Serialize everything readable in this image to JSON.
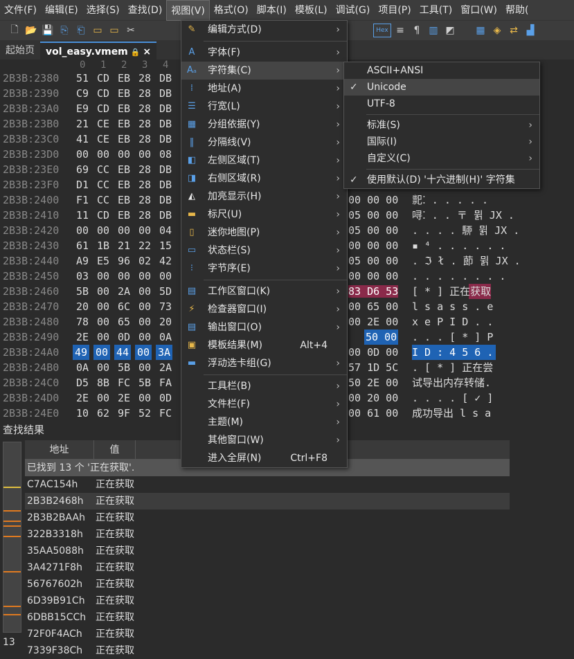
{
  "menubar": [
    "文件(F)",
    "编辑(E)",
    "选择(S)",
    "查找(D)",
    "视图(V)",
    "格式(O)",
    "脚本(I)",
    "模板(L)",
    "调试(G)",
    "项目(P)",
    "工具(T)",
    "窗口(W)",
    "帮助("
  ],
  "tabs": {
    "start": "起始页",
    "file": "vol_easy.vmem",
    "close": "×"
  },
  "editor": {
    "col_header": [
      "0",
      "1",
      "2",
      "3",
      "4"
    ],
    "rows": [
      {
        "addr": "2B3B:2380",
        "hex": [
          "51",
          "CD",
          "EB",
          "28",
          "DB"
        ],
        "right": "",
        "asc": ""
      },
      {
        "addr": "2B3B:2390",
        "hex": [
          "C9",
          "CD",
          "EB",
          "28",
          "DB"
        ],
        "right": "",
        "asc": ""
      },
      {
        "addr": "2B3B:23A0",
        "hex": [
          "E9",
          "CD",
          "EB",
          "28",
          "DB"
        ],
        "right": "",
        "asc": ""
      },
      {
        "addr": "2B3B:23B0",
        "hex": [
          "21",
          "CE",
          "EB",
          "28",
          "DB"
        ],
        "right": "",
        "asc": ""
      },
      {
        "addr": "2B3B:23C0",
        "hex": [
          "41",
          "CE",
          "EB",
          "28",
          "DB"
        ],
        "right": "",
        "asc": ""
      },
      {
        "addr": "2B3B:23D0",
        "hex": [
          "00",
          "00",
          "00",
          "00",
          "08"
        ],
        "right": "",
        "asc": ""
      },
      {
        "addr": "2B3B:23E0",
        "hex": [
          "69",
          "CC",
          "EB",
          "28",
          "DB"
        ],
        "right": "",
        "asc": ""
      },
      {
        "addr": "2B3B:23F0",
        "hex": [
          "D1",
          "CC",
          "EB",
          "28",
          "DB"
        ],
        "right": "",
        "asc": ""
      },
      {
        "addr": "2B3B:2400",
        "hex": [
          "F1",
          "CC",
          "EB",
          "28",
          "DB"
        ],
        "right": "00 00 00",
        "asc": "䄐⁚ . . . . ."
      },
      {
        "addr": "2B3B:2410",
        "hex": [
          "11",
          "CD",
          "EB",
          "28",
          "DB"
        ],
        "right": "05 00 00",
        "asc": "㖊⁚ . . 〒 뮑 JX ."
      },
      {
        "addr": "2B3B:2420",
        "hex": [
          "00",
          "00",
          "00",
          "00",
          "04"
        ],
        "right": "05 00 00",
        "asc": ". . . . 駵 뮑 JX ."
      },
      {
        "addr": "2B3B:2430",
        "hex": [
          "61",
          "1B",
          "21",
          "22",
          "15"
        ],
        "right": "00 00 00",
        "asc": "▪ ⁴ . . . . . ."
      },
      {
        "addr": "2B3B:2440",
        "hex": [
          "A9",
          "E5",
          "96",
          "02",
          "42"
        ],
        "right": "05 00 00",
        "asc": ". ℑ ł . 莭 뮑 JX ."
      },
      {
        "addr": "2B3B:2450",
        "hex": [
          "03",
          "00",
          "00",
          "00",
          "00"
        ],
        "right": "00 00 00",
        "asc": ". . . . . . . ."
      },
      {
        "addr": "2B3B:2460",
        "hex": [
          "5B",
          "00",
          "2A",
          "00",
          "5D"
        ],
        "right": "83 D6 53",
        "asc": "[ * ]  正在获取"
      },
      {
        "addr": "2B3B:2470",
        "hex": [
          "20",
          "00",
          "6C",
          "00",
          "73"
        ],
        "right": "00 65 00",
        "asc": "  l s a s s . e"
      },
      {
        "addr": "2B3B:2480",
        "hex": [
          "78",
          "00",
          "65",
          "00",
          "20"
        ],
        "right": "00 2E 00",
        "asc": "x e   P I D . ."
      },
      {
        "addr": "2B3B:2490",
        "hex": [
          "2E",
          "00",
          "0D",
          "00",
          "0A"
        ],
        "right": "50 00",
        "asc": ". . . [ * ]   P"
      },
      {
        "addr": "2B3B:24A0",
        "hex": [
          "49",
          "00",
          "44",
          "00",
          "3A"
        ],
        "right": "00 0D 00",
        "asc": "I D :   4 5 6 ."
      },
      {
        "addr": "2B3B:24B0",
        "hex": [
          "0A",
          "00",
          "5B",
          "00",
          "2A"
        ],
        "right": "57 1D 5C",
        "asc": ". [ * ]   正在尝"
      },
      {
        "addr": "2B3B:24C0",
        "hex": [
          "D5",
          "8B",
          "FC",
          "5B",
          "FA"
        ],
        "right": "50 2E 00",
        "asc": "试导出内存转储."
      },
      {
        "addr": "2B3B:24D0",
        "hex": [
          "2E",
          "00",
          "2E",
          "00",
          "0D"
        ],
        "right": "00 20 00",
        "asc": ". . . . [ ✓ ]"
      },
      {
        "addr": "2B3B:24E0",
        "hex": [
          "10",
          "62",
          "9F",
          "52",
          "FC"
        ],
        "right": "00 61 00",
        "asc": "成功导出  l s a"
      }
    ]
  },
  "find": {
    "title": "查找结果",
    "col_addr": "地址",
    "col_val": "值",
    "summary": "已找到 13 个 '正在获取'.",
    "count": "13",
    "rows": [
      {
        "addr": "C7AC154h",
        "val": "正在获取"
      },
      {
        "addr": "2B3B2468h",
        "val": "正在获取"
      },
      {
        "addr": "2B3B2BAAh",
        "val": "正在获取"
      },
      {
        "addr": "322B3318h",
        "val": "正在获取"
      },
      {
        "addr": "35AA5088h",
        "val": "正在获取"
      },
      {
        "addr": "3A4271F8h",
        "val": "正在获取"
      },
      {
        "addr": "56767602h",
        "val": "正在获取"
      },
      {
        "addr": "6D39B91Ch",
        "val": "正在获取"
      },
      {
        "addr": "6DBB15CCh",
        "val": "正在获取"
      },
      {
        "addr": "72F0F4ACh",
        "val": "正在获取"
      },
      {
        "addr": "7339F38Ch",
        "val": "正在获取"
      }
    ]
  },
  "view_menu": [
    {
      "label": "编辑方式(D)",
      "icon": "pencil-icon",
      "arrow": true
    },
    {
      "sep": true
    },
    {
      "label": "字体(F)",
      "icon": "font-icon",
      "arrow": true
    },
    {
      "label": "字符集(C)",
      "icon": "charset-icon",
      "arrow": true,
      "hover": true
    },
    {
      "label": "地址(A)",
      "icon": "address-icon",
      "arrow": true
    },
    {
      "label": "行宽(L)",
      "icon": "line-width-icon",
      "arrow": true
    },
    {
      "label": "分组依据(Y)",
      "icon": "group-icon",
      "arrow": true
    },
    {
      "label": "分隔线(V)",
      "icon": "divider-icon",
      "arrow": true
    },
    {
      "label": "左侧区域(T)",
      "icon": "left-area-icon",
      "arrow": true
    },
    {
      "label": "右侧区域(R)",
      "icon": "right-area-icon",
      "arrow": true
    },
    {
      "label": "加亮显示(H)",
      "icon": "highlight-icon",
      "arrow": true
    },
    {
      "label": "标尺(U)",
      "icon": "ruler-icon",
      "arrow": true
    },
    {
      "label": "迷你地图(P)",
      "icon": "minimap-icon",
      "arrow": true
    },
    {
      "label": "状态栏(S)",
      "icon": "statusbar-icon",
      "arrow": true
    },
    {
      "label": "字节序(E)",
      "icon": "byte-order-icon",
      "arrow": true
    },
    {
      "sep": true
    },
    {
      "label": "工作区窗口(K)",
      "icon": "workspace-icon",
      "arrow": true
    },
    {
      "label": "检查器窗口(I)",
      "icon": "inspector-icon",
      "arrow": true
    },
    {
      "label": "输出窗口(O)",
      "icon": "output-icon",
      "arrow": true
    },
    {
      "label": "模板结果(M)",
      "icon": "template-icon",
      "shortcut": "Alt+4"
    },
    {
      "label": "浮动选卡组(G)",
      "icon": "floating-tab-icon",
      "arrow": true
    },
    {
      "sep": true
    },
    {
      "label": "工具栏(B)",
      "arrow": true
    },
    {
      "label": "文件栏(F)",
      "arrow": true
    },
    {
      "label": "主题(M)",
      "arrow": true
    },
    {
      "label": "其他窗口(W)",
      "arrow": true
    },
    {
      "label": "进入全屏(N)",
      "shortcut": "Ctrl+F8"
    }
  ],
  "charset_menu": [
    {
      "label": "ASCII+ANSI"
    },
    {
      "label": "Unicode",
      "checked": true,
      "hover": true
    },
    {
      "label": "UTF-8"
    },
    {
      "sep": true
    },
    {
      "label": "标准(S)",
      "arrow": true
    },
    {
      "label": "国际(I)",
      "arrow": true
    },
    {
      "label": "自定义(C)",
      "arrow": true
    },
    {
      "sep": true
    },
    {
      "label": "使用默认(D) '十六进制(H)' 字符集",
      "checked": true
    }
  ]
}
